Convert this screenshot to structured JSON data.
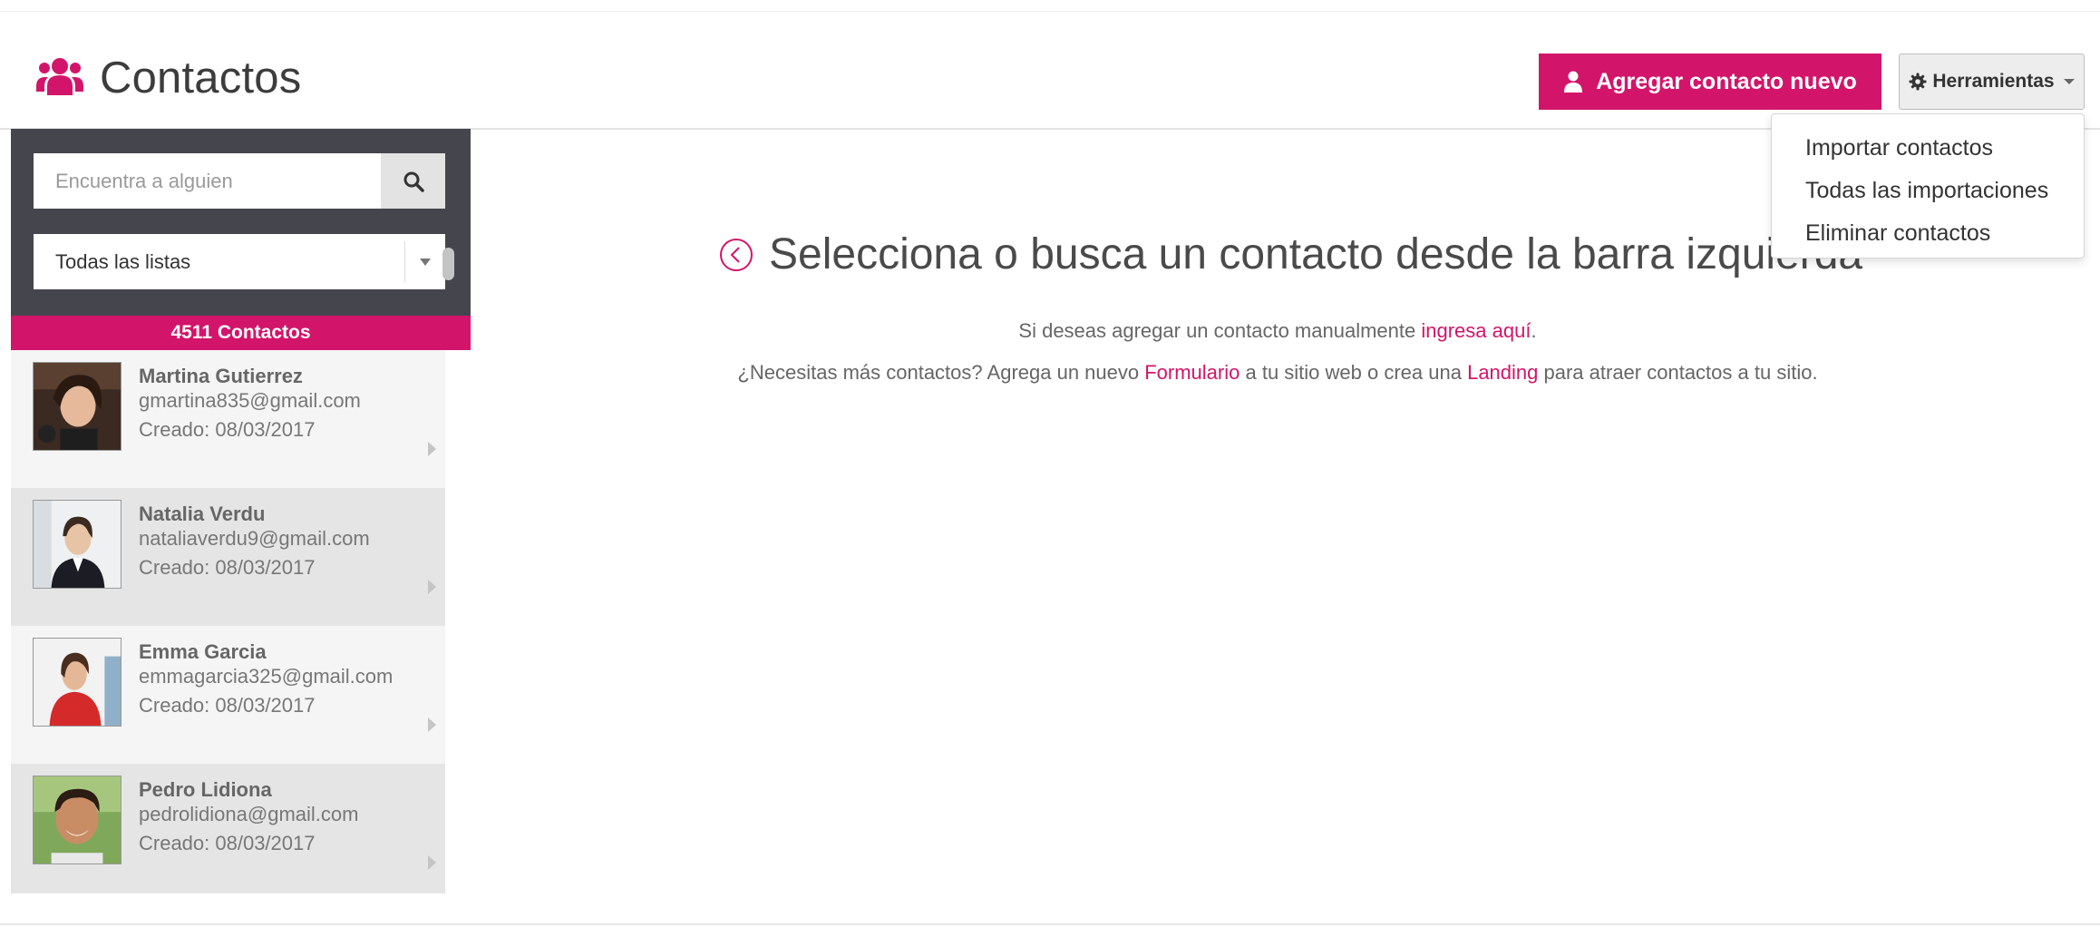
{
  "header": {
    "title": "Contactos",
    "add_button_label": "Agregar contacto nuevo",
    "tools_button_label": "Herramientas",
    "tools_menu": [
      "Importar contactos",
      "Todas las importaciones",
      "Eliminar contactos"
    ]
  },
  "sidebar": {
    "search_placeholder": "Encuentra a alguien",
    "list_filter_value": "Todas las listas",
    "contact_count": "4511 Contactos",
    "contacts": [
      {
        "name": "Martina Gutierrez",
        "email": "gmartina835@gmail.com",
        "created": "Creado: 08/03/2017"
      },
      {
        "name": "Natalia Verdu",
        "email": "nataliaverdu9@gmail.com",
        "created": "Creado: 08/03/2017"
      },
      {
        "name": "Emma Garcia",
        "email": "emmagarcia325@gmail.com",
        "created": "Creado: 08/03/2017"
      },
      {
        "name": "Pedro Lidiona",
        "email": "pedrolidiona@gmail.com",
        "created": "Creado: 08/03/2017"
      }
    ]
  },
  "main": {
    "empty_title": "Selecciona o busca un contacto desde la barra izquierda",
    "hint1": {
      "prefix": "Si deseas agregar un contacto manualmente ",
      "link": "ingresa aquí",
      "suffix": "."
    },
    "hint2": {
      "prefix": "¿Necesitas más contactos? Agrega un nuevo ",
      "link1": "Formulario",
      "middle": " a tu sitio web o crea una ",
      "link2": "Landing",
      "suffix": " para atraer contactos a tu sitio."
    }
  },
  "colors": {
    "accent": "#d2156a",
    "sidebar_header": "#45454d"
  }
}
